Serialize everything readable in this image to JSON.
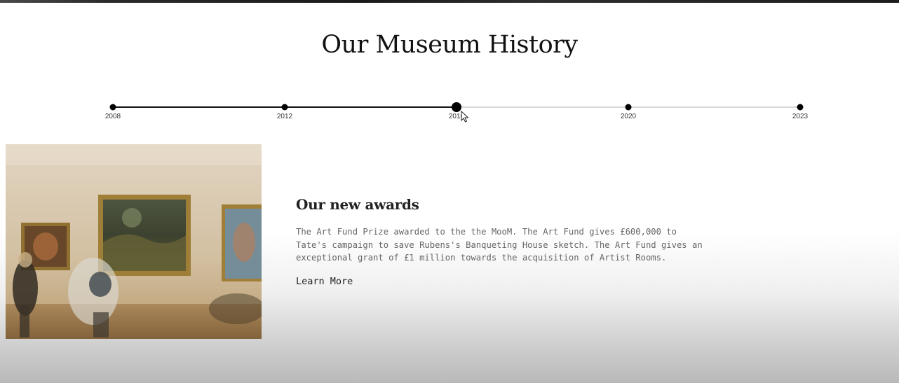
{
  "header": {
    "title": "Our Museum History"
  },
  "timeline": {
    "active_index": 2,
    "progress_percent": 50,
    "points": [
      {
        "year": "2008"
      },
      {
        "year": "2012"
      },
      {
        "year": "2016"
      },
      {
        "year": "2020"
      },
      {
        "year": "2023"
      }
    ]
  },
  "content": {
    "image_icon": "gallery-photo",
    "heading": "Our new awards",
    "body": "The Art Fund Prize awarded to the the MooM. The Art Fund gives £600,000 to Tate's campaign to save Rubens's Banqueting House sketch. The Art Fund gives an exceptional grant of £1 million towards the acquisition of Artist Rooms.",
    "cta_label": "Learn More"
  },
  "colors": {
    "text": "#111111",
    "track_inactive": "#d9d9d9",
    "track_active": "#111111",
    "body_text": "#666666"
  }
}
